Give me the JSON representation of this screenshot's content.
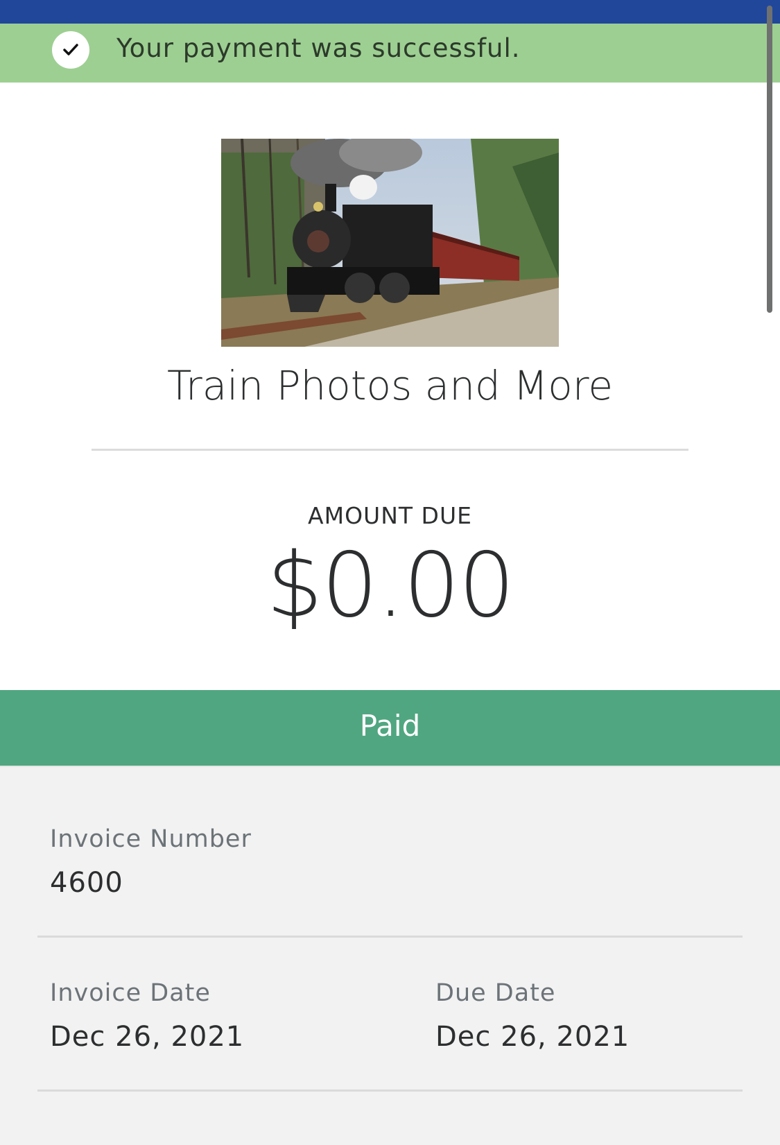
{
  "banner": {
    "message": "Your payment was successful.",
    "icon": "check-icon",
    "color": "#9dcf92"
  },
  "top_strip_color": "#21479b",
  "invoice": {
    "merchant_name": "Train Photos and More",
    "hero_image": "steam-locomotive-photo",
    "amount_label": "AMOUNT DUE",
    "amount_value": "$0.00",
    "status": "Paid",
    "status_color": "#50a680"
  },
  "details": {
    "invoice_number_label": "Invoice Number",
    "invoice_number_value": "4600",
    "invoice_date_label": "Invoice Date",
    "invoice_date_value": "Dec 26, 2021",
    "due_date_label": "Due Date",
    "due_date_value": "Dec 26, 2021"
  }
}
